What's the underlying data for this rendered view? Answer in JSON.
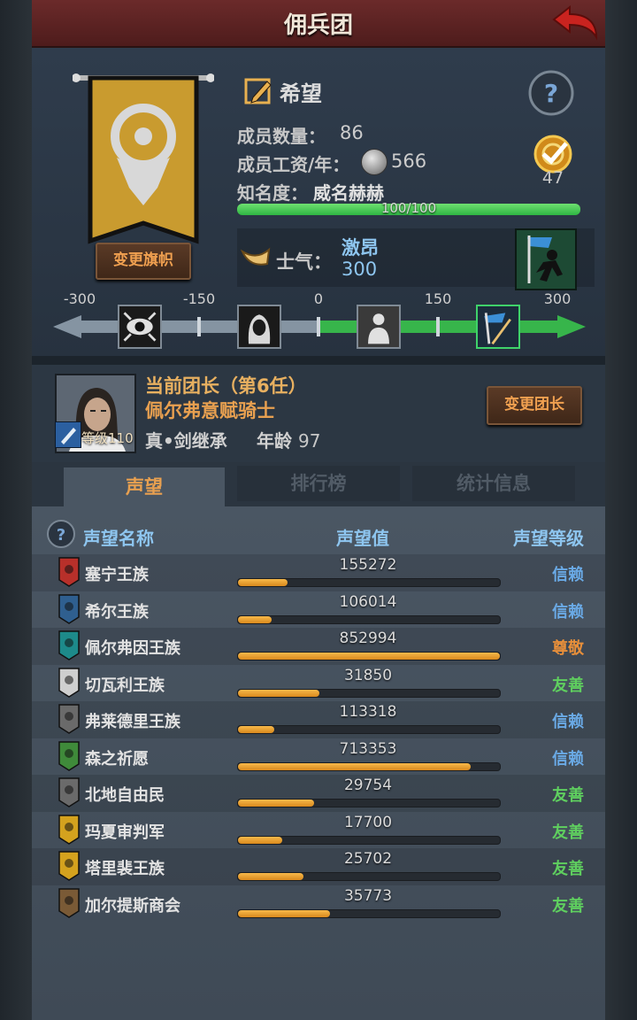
{
  "header": {
    "title": "佣兵团"
  },
  "company": {
    "banner_button": "变更旗帜",
    "name": "希望",
    "members_label": "成员数量：",
    "members_value": "86",
    "wage_label": "成员工资/年：",
    "wage_value": "566",
    "fame_label": "知名度：",
    "fame_value": "威名赫赫",
    "fame_progress_text": "100/100",
    "fame_progress": 1.0,
    "quest_count": "47",
    "morale_label": "士气：",
    "morale_state": "激昂",
    "morale_value": "300"
  },
  "morale_scale": {
    "ticks": [
      "-300",
      "-150",
      "0",
      "150",
      "300"
    ],
    "min": -300,
    "max": 300,
    "current": 300,
    "stages": [
      "despair-eye-icon",
      "fear-hooded-icon",
      "calm-figure-icon",
      "rally-banner-icon"
    ]
  },
  "leader": {
    "title": "当前团长（第6任）",
    "name": "佩尔弗意赋骑士",
    "level_label": "等级110",
    "skill": "真•剑继承",
    "age_label": "年龄",
    "age_value": "97",
    "change_button": "变更团长"
  },
  "tabs": [
    "声望",
    "排行榜",
    "统计信息"
  ],
  "reputation": {
    "headers": {
      "name": "声望名称",
      "value": "声望值",
      "rank": "声望等级"
    },
    "colors": {
      "信赖": "#6aaae6",
      "尊敬": "#e88f3a",
      "友善": "#5fcf5f"
    },
    "rows": [
      {
        "name": "塞宁王族",
        "value": "155272",
        "fill": 0.19,
        "rank": "信赖",
        "crest": "red-tower-crest-icon"
      },
      {
        "name": "希尔王族",
        "value": "106014",
        "fill": 0.13,
        "rank": "信赖",
        "crest": "blue-helm-crest-icon"
      },
      {
        "name": "佩尔弗因王族",
        "value": "852994",
        "fill": 1.0,
        "rank": "尊敬",
        "crest": "teal-wave-crest-icon"
      },
      {
        "name": "切瓦利王族",
        "value": "31850",
        "fill": 0.31,
        "rank": "友善",
        "crest": "white-scale-crest-icon"
      },
      {
        "name": "弗莱德里王族",
        "value": "113318",
        "fill": 0.14,
        "rank": "信赖",
        "crest": "grey-skull-crest-icon"
      },
      {
        "name": "森之祈愿",
        "value": "713353",
        "fill": 0.89,
        "rank": "信赖",
        "crest": "green-tree-crest-icon"
      },
      {
        "name": "北地自由民",
        "value": "29754",
        "fill": 0.29,
        "rank": "友善",
        "crest": "grey-axe-crest-icon"
      },
      {
        "name": "玛夏审判军",
        "value": "17700",
        "fill": 0.17,
        "rank": "友善",
        "crest": "gold-sword-crest-icon"
      },
      {
        "name": "塔里裴王族",
        "value": "25702",
        "fill": 0.25,
        "rank": "友善",
        "crest": "gold-crown-crest-icon"
      },
      {
        "name": "加尔提斯商会",
        "value": "35773",
        "fill": 0.35,
        "rank": "友善",
        "crest": "brown-chest-crest-icon"
      }
    ]
  }
}
